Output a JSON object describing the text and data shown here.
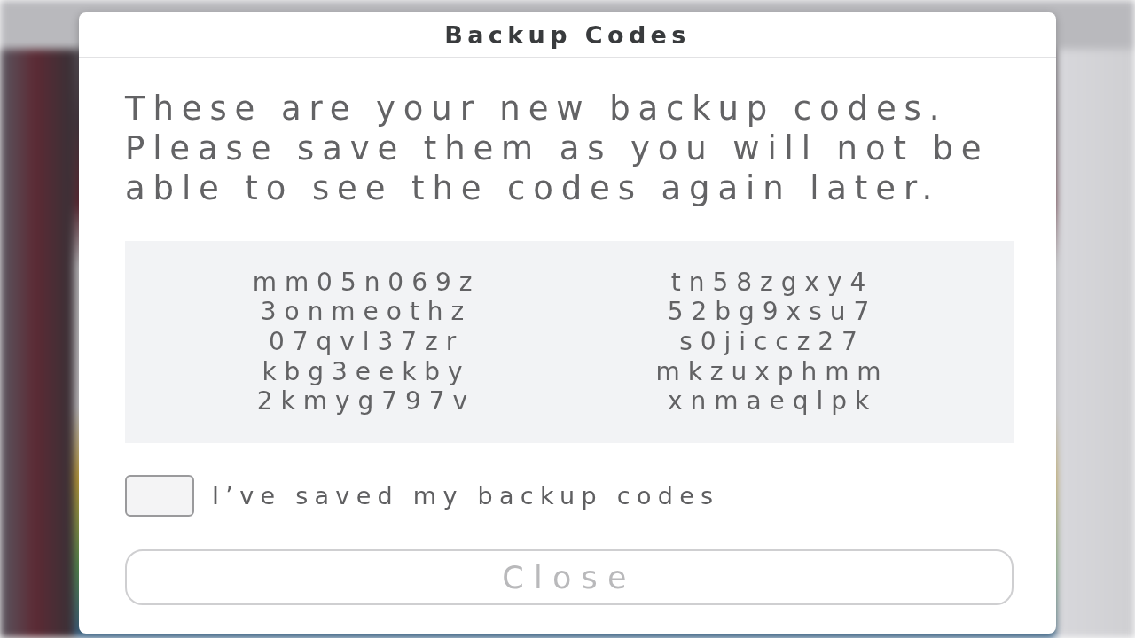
{
  "dialog": {
    "title": "Backup Codes",
    "message": "These are your new backup codes. Please save them as you will not be able to see the codes again later.",
    "codes": [
      "mm05n069z",
      "tn58zgxy4",
      "3onmeothz",
      "52bg9xsu7",
      "07qvl37zr",
      "s0jiccz27",
      "kbg3eekby",
      "mkzuxphmm",
      "2kmyg797v",
      "xnmaeqlpk"
    ],
    "confirm_checkbox": {
      "label": "I’ve saved my backup codes",
      "checked": false
    },
    "close_button": {
      "label": "Close",
      "disabled": true
    }
  }
}
